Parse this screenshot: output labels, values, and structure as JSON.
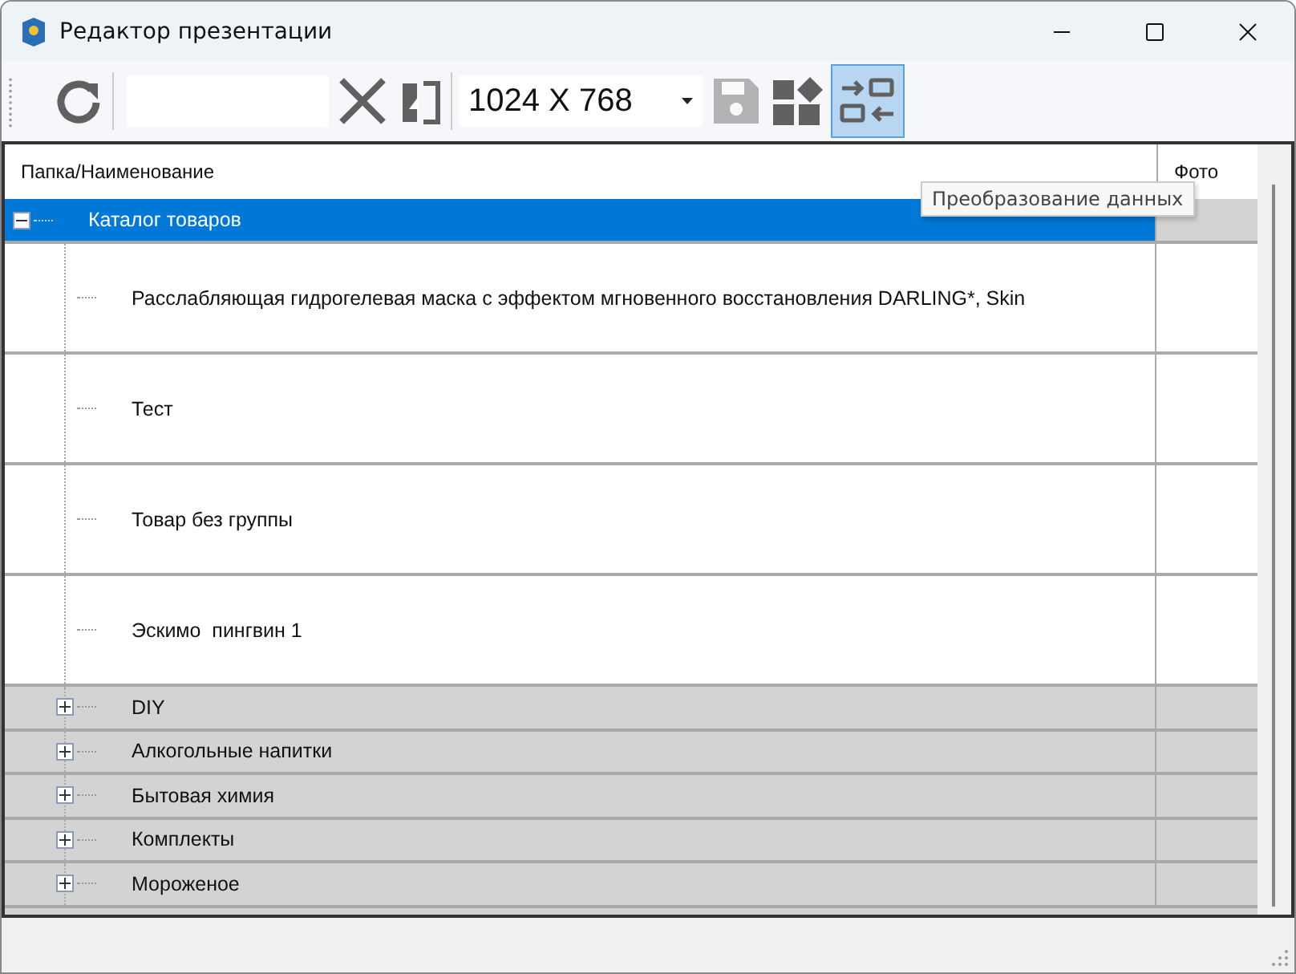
{
  "window": {
    "title": "Редактор презентации"
  },
  "toolbar": {
    "resolution": {
      "value": "1024 X 768"
    },
    "save_disabled": true,
    "convert_pressed": true
  },
  "tooltip": "Преобразование данных",
  "table": {
    "columns": [
      "Папка/Наименование",
      "Фото"
    ],
    "root": {
      "label": "Каталог товаров",
      "expanded": true,
      "selected": true,
      "children": [
        {
          "kind": "item",
          "label": "Расслабляющая гидрогелевая маска с эффектом мгновенного восстановления DARLING*, Skin"
        },
        {
          "kind": "item",
          "label": "Тест"
        },
        {
          "kind": "item",
          "label": "Товар без группы"
        },
        {
          "kind": "item",
          "label": "Эскимо  пингвин 1"
        },
        {
          "kind": "group",
          "label": "DIY",
          "expanded": false
        },
        {
          "kind": "group",
          "label": "Алкогольные напитки",
          "expanded": false
        },
        {
          "kind": "group",
          "label": "Бытовая химия",
          "expanded": false
        },
        {
          "kind": "group",
          "label": "Комплекты",
          "expanded": false
        },
        {
          "kind": "group",
          "label": "Мороженое",
          "expanded": false
        }
      ]
    }
  }
}
